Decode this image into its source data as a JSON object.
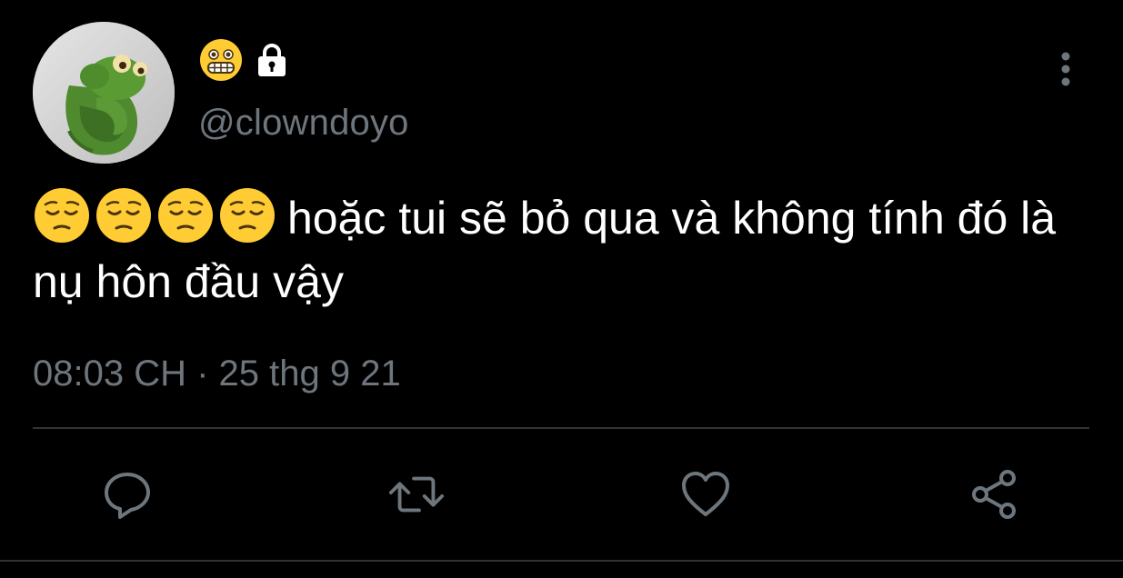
{
  "author": {
    "display_name_emoji": "grimacing-face-emoji",
    "lock_icon": "lock-icon",
    "handle": "@clowndoyo",
    "avatar_icon": "green-plush-frog-avatar"
  },
  "menu": {
    "icon": "more-vertical-icon"
  },
  "tweet": {
    "leading_emojis": [
      "pensive-face-emoji",
      "pensive-face-emoji",
      "pensive-face-emoji",
      "pensive-face-emoji"
    ],
    "text": "hoặc tui sẽ bỏ qua và không tính đó là nụ hôn đầu vậy"
  },
  "timestamp": "08:03 CH · 25 thg 9 21",
  "actions": [
    {
      "name": "reply",
      "icon": "reply-icon"
    },
    {
      "name": "retweet",
      "icon": "retweet-icon"
    },
    {
      "name": "like",
      "icon": "heart-icon"
    },
    {
      "name": "share",
      "icon": "share-icon"
    }
  ],
  "colors": {
    "background": "#000000",
    "text_primary": "#ffffff",
    "text_secondary": "#6e767d",
    "divider": "#2f3336",
    "emoji_yellow": "#ffcc33"
  }
}
